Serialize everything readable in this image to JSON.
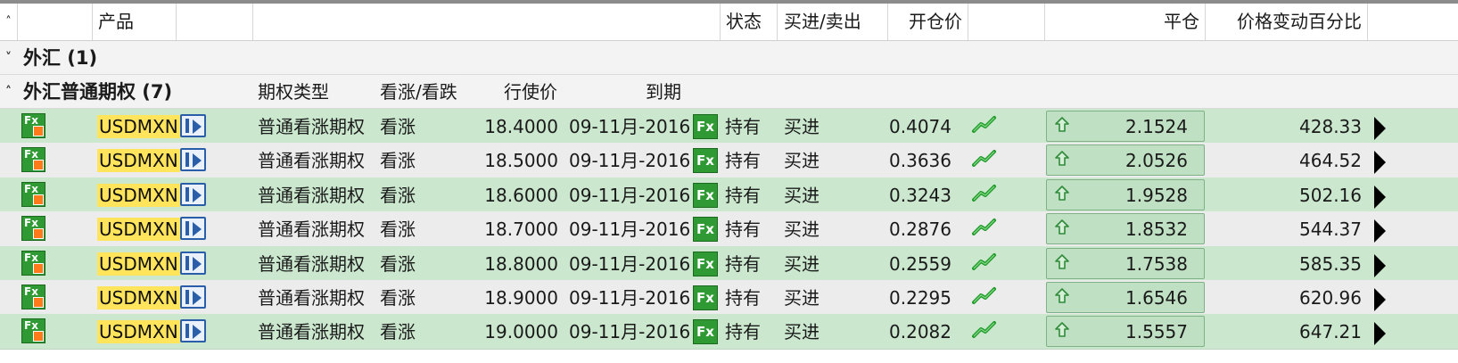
{
  "header": {
    "sort_glyph": "˄",
    "product": "产品",
    "status": "状态",
    "side": "买进/卖出",
    "open_price": "开仓价",
    "close": "平仓",
    "pct_change": "价格变动百分比"
  },
  "groups": [
    {
      "chevron": "˅",
      "title": "外汇 (1)"
    },
    {
      "chevron": "˄",
      "title": "外汇普通期权 (7)",
      "sub": {
        "option_type": "期权类型",
        "call_put": "看涨/看跌",
        "strike": "行使价",
        "expiry": "到期"
      }
    }
  ],
  "rows": [
    {
      "symbol": "USDMXN",
      "type": "普通看涨期权",
      "callput": "看涨",
      "strike": "18.4000",
      "expiry": "09-11月-2016",
      "fx": "Fx",
      "status": "持有",
      "side": "买进",
      "open": "0.4074",
      "close": "2.1524",
      "pct": "428.33",
      "bg": "green"
    },
    {
      "symbol": "USDMXN",
      "type": "普通看涨期权",
      "callput": "看涨",
      "strike": "18.5000",
      "expiry": "09-11月-2016",
      "fx": "Fx",
      "status": "持有",
      "side": "买进",
      "open": "0.3636",
      "close": "2.0526",
      "pct": "464.52",
      "bg": "grey"
    },
    {
      "symbol": "USDMXN",
      "type": "普通看涨期权",
      "callput": "看涨",
      "strike": "18.6000",
      "expiry": "09-11月-2016",
      "fx": "Fx",
      "status": "持有",
      "side": "买进",
      "open": "0.3243",
      "close": "1.9528",
      "pct": "502.16",
      "bg": "green"
    },
    {
      "symbol": "USDMXN",
      "type": "普通看涨期权",
      "callput": "看涨",
      "strike": "18.7000",
      "expiry": "09-11月-2016",
      "fx": "Fx",
      "status": "持有",
      "side": "买进",
      "open": "0.2876",
      "close": "1.8532",
      "pct": "544.37",
      "bg": "grey"
    },
    {
      "symbol": "USDMXN",
      "type": "普通看涨期权",
      "callput": "看涨",
      "strike": "18.8000",
      "expiry": "09-11月-2016",
      "fx": "Fx",
      "status": "持有",
      "side": "买进",
      "open": "0.2559",
      "close": "1.7538",
      "pct": "585.35",
      "bg": "green"
    },
    {
      "symbol": "USDMXN",
      "type": "普通看涨期权",
      "callput": "看涨",
      "strike": "18.9000",
      "expiry": "09-11月-2016",
      "fx": "Fx",
      "status": "持有",
      "side": "买进",
      "open": "0.2295",
      "close": "1.6546",
      "pct": "620.96",
      "bg": "grey"
    },
    {
      "symbol": "USDMXN",
      "type": "普通看涨期权",
      "callput": "看涨",
      "strike": "19.0000",
      "expiry": "09-11月-2016",
      "fx": "Fx",
      "status": "持有",
      "side": "买进",
      "open": "0.2082",
      "close": "1.5557",
      "pct": "647.21",
      "bg": "green"
    }
  ],
  "icons": {
    "product_type": "fx-option-icon",
    "info": "info-play-icon",
    "trend": "trend-up-icon",
    "close_arrow": "up-arrow-icon",
    "expand": "expand-triangle-icon"
  },
  "colors": {
    "row_green": "#cbe8cf",
    "row_grey": "#ececec",
    "symbol_highlight": "#ffe45c"
  }
}
